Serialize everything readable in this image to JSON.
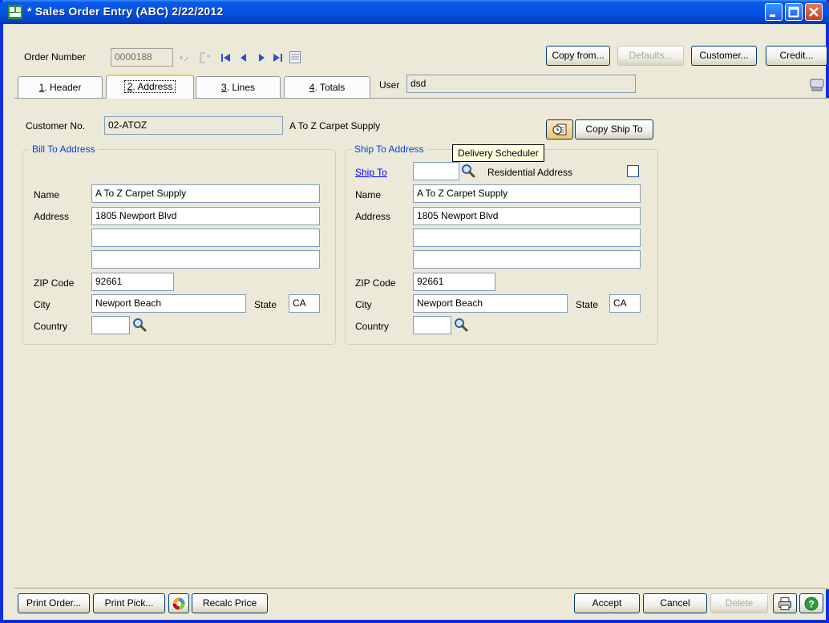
{
  "window": {
    "title": "* Sales Order Entry (ABC) 2/22/2012"
  },
  "order": {
    "label": "Order Number",
    "value": "0000188"
  },
  "top_buttons": {
    "copy_from": "Copy from...",
    "defaults": "Defaults...",
    "customer": "Customer...",
    "credit": "Credit..."
  },
  "tabs": [
    {
      "key": "1",
      "label": ". Header"
    },
    {
      "key": "2",
      "label": ". Address"
    },
    {
      "key": "3",
      "label": ". Lines"
    },
    {
      "key": "4",
      "label": ". Totals"
    }
  ],
  "user": {
    "label": "User",
    "value": "dsd"
  },
  "customer": {
    "label": "Customer No.",
    "number": "02-ATOZ",
    "name": "A To Z Carpet Supply"
  },
  "copy_ship_to": "Copy Ship To",
  "tooltip": "Delivery Scheduler",
  "bill_to": {
    "title": "Bill To Address",
    "name_label": "Name",
    "name": "A To Z Carpet Supply",
    "address_label": "Address",
    "address1": "1805 Newport Blvd",
    "address2": "",
    "address3": "",
    "zip_label": "ZIP Code",
    "zip": "92661",
    "city_label": "City",
    "city": "Newport Beach",
    "state_label": "State",
    "state": "CA",
    "country_label": "Country",
    "country": ""
  },
  "ship_to": {
    "title": "Ship To Address",
    "ship_to_label": "Ship To",
    "ship_to_code": "",
    "residential_label": "Residential Address",
    "residential": false,
    "name_label": "Name",
    "name": "A To Z Carpet Supply",
    "address_label": "Address",
    "address1": "1805 Newport Blvd",
    "address2": "",
    "address3": "",
    "zip_label": "ZIP Code",
    "zip": "92661",
    "city_label": "City",
    "city": "Newport Beach",
    "state_label": "State",
    "state": "CA",
    "country_label": "Country",
    "country": ""
  },
  "bottom_buttons": {
    "print_order": "Print Order...",
    "print_pick": "Print Pick...",
    "recalc_price": "Recalc Price",
    "accept": "Accept",
    "cancel": "Cancel",
    "delete": "Delete"
  },
  "icons": {
    "app": "sales-order-app-icon",
    "nav_first": "first-record-icon",
    "nav_prev": "previous-record-icon",
    "nav_next": "next-record-icon",
    "nav_last": "last-record-icon",
    "lookup": "magnifier-icon",
    "print": "printer-icon",
    "help": "help-icon"
  },
  "colors": {
    "titlebar": "#0553e0",
    "group_title": "#0046d5",
    "link": "#0000ff",
    "tooltip_bg": "#ffffe1"
  }
}
